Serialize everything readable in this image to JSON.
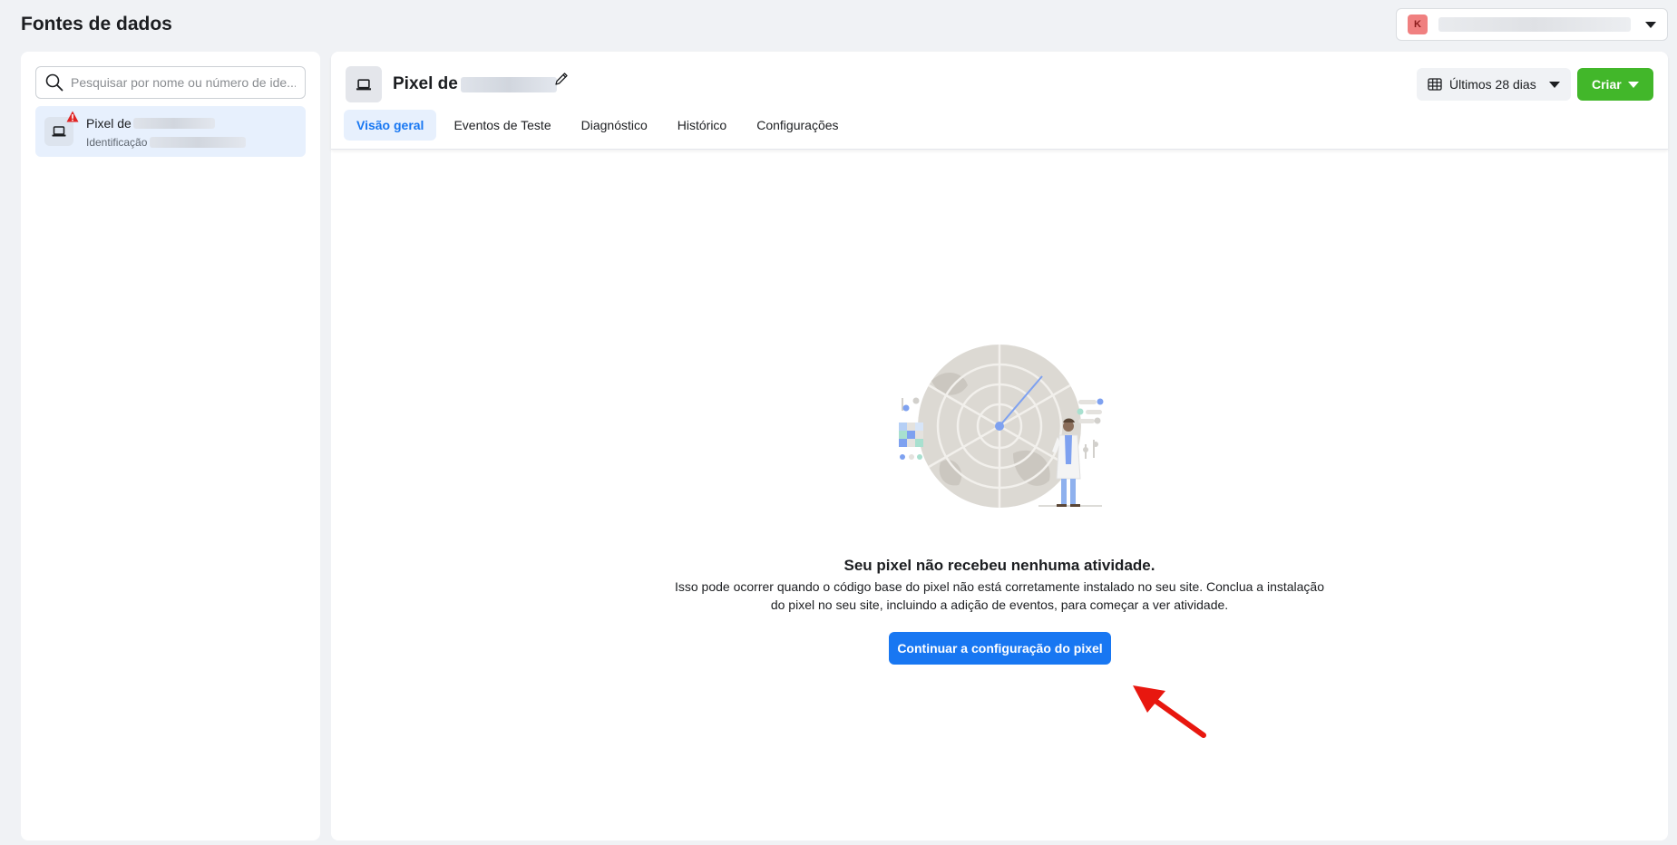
{
  "page": {
    "title": "Fontes de dados"
  },
  "account": {
    "avatar_letter": "K"
  },
  "sidebar": {
    "search_placeholder": "Pesquisar por nome ou número de ide...",
    "items": [
      {
        "name": "Pixel de",
        "id_label": "Identificação"
      }
    ]
  },
  "header": {
    "pixel_title": "Pixel de",
    "date_range": "Últimos 28 dias",
    "create_label": "Criar",
    "tabs": [
      {
        "label": "Visão geral",
        "active": true
      },
      {
        "label": "Eventos de Teste",
        "active": false
      },
      {
        "label": "Diagnóstico",
        "active": false
      },
      {
        "label": "Histórico",
        "active": false
      },
      {
        "label": "Configurações",
        "active": false
      }
    ]
  },
  "empty_state": {
    "title": "Seu pixel não recebeu nenhuma atividade.",
    "description": "Isso pode ocorrer quando o código base do pixel não está corretamente instalado no seu site. Conclua a instalação do pixel no seu site, incluindo a adição de eventos, para começar a ver atividade.",
    "button_label": "Continuar a configuração do pixel"
  },
  "colors": {
    "primary": "#1877f2",
    "success": "#42b72a",
    "warning": "#e02424",
    "annotation_arrow": "#e8170f"
  },
  "icons": [
    "search-icon",
    "laptop-icon",
    "warning-icon",
    "pencil-icon",
    "calendar-table-icon",
    "chevron-down-icon",
    "radar-illustration",
    "red-arrow-annotation"
  ]
}
